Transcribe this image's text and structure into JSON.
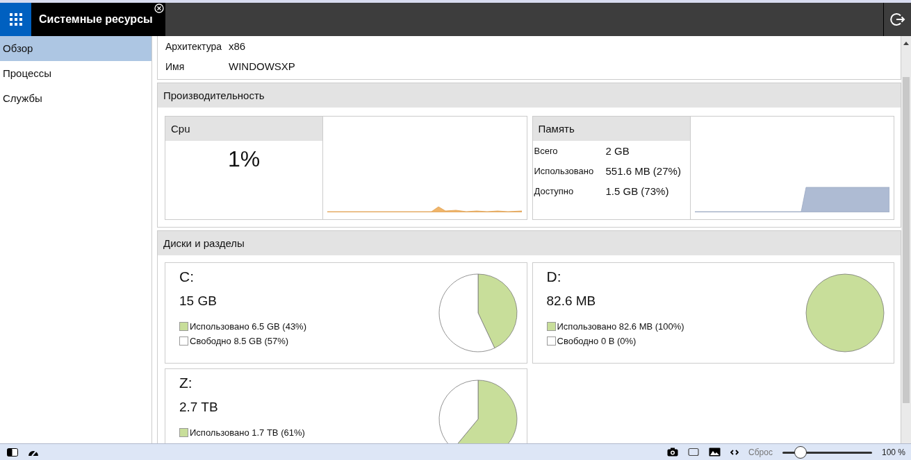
{
  "app_bar": {
    "title": "Системные ресурсы"
  },
  "sidebar": {
    "items": [
      {
        "label": "Обзор",
        "selected": true
      },
      {
        "label": "Процессы",
        "selected": false
      },
      {
        "label": "Службы",
        "selected": false
      }
    ]
  },
  "system_info": [
    {
      "label": "Архитектура",
      "value": "x86"
    },
    {
      "label": "Имя",
      "value": "WINDOWSXP"
    }
  ],
  "performance": {
    "title": "Производительность",
    "cpu": {
      "title": "Cpu",
      "value": "1%"
    },
    "memory": {
      "title": "Память",
      "rows": [
        {
          "label": "Всего",
          "value": "2 GB"
        },
        {
          "label": "Использовано",
          "value": "551.6 MB (27%)"
        },
        {
          "label": "Доступно",
          "value": "1.5 GB (73%)"
        }
      ]
    }
  },
  "disks": {
    "title": "Диски и разделы",
    "items": [
      {
        "name": "C:",
        "size": "15 GB",
        "legend": [
          {
            "label": "Использовано 6.5 GB (43%)",
            "color": "#c8de9a"
          },
          {
            "label": "Свободно 8.5 GB (57%)",
            "color": "#ffffff"
          }
        ],
        "chart_data": {
          "type": "pie",
          "values": [
            43,
            57
          ]
        }
      },
      {
        "name": "D:",
        "size": "82.6 MB",
        "legend": [
          {
            "label": "Использовано 82.6 MB (100%)",
            "color": "#c8de9a"
          },
          {
            "label": "Свободно 0 B (0%)",
            "color": "#ffffff"
          }
        ],
        "chart_data": {
          "type": "pie",
          "values": [
            100,
            0
          ]
        }
      },
      {
        "name": "Z:",
        "size": "2.7 TB",
        "legend": [
          {
            "label": "Использовано 1.7 TB (61%)",
            "color": "#c8de9a"
          }
        ],
        "chart_data": {
          "type": "pie",
          "values": [
            61,
            39
          ]
        }
      }
    ]
  },
  "status_bar": {
    "reset": "Сброс",
    "zoom": {
      "level": 0.2
    },
    "zoom_reading": "100 %"
  }
}
